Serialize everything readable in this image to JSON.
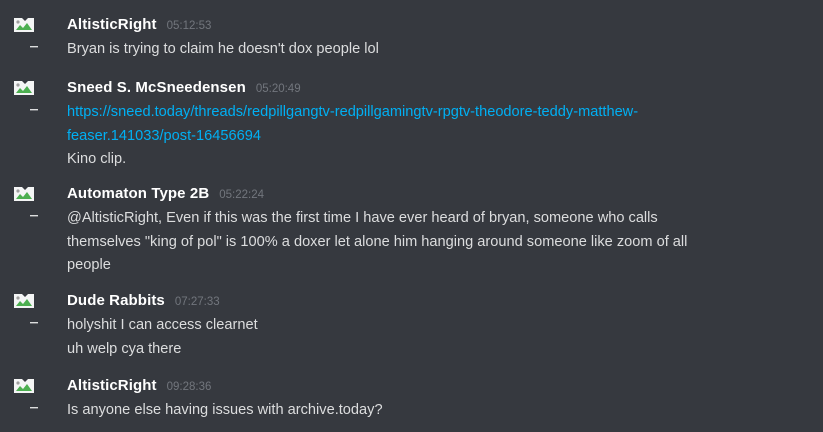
{
  "messages": [
    {
      "username": "AltisticRight",
      "timestamp": "05:12:53",
      "lines": [
        "Bryan is trying to claim he doesn't dox people lol"
      ]
    },
    {
      "username": "Sneed S. McSneedensen",
      "timestamp": "05:20:49",
      "link": {
        "line1": "https://sneed.today/threads/redpillgangtv-redpillgamingtv-rpgtv-theodore-teddy-matthew-",
        "line2": "feaser.141033/post-16456694"
      },
      "lines": [
        "Kino clip."
      ]
    },
    {
      "username": "Automaton Type 2B",
      "timestamp": "05:22:24",
      "lines": [
        "@AltisticRight, Even if this was the first time I have ever heard of bryan, someone who calls",
        "themselves \"king of pol\" is 100% a doxer let alone him hanging around someone like zoom of all",
        "people"
      ]
    },
    {
      "username": "Dude Rabbits",
      "timestamp": "07:27:33",
      "lines": [
        "holyshit I can access clearnet",
        "uh welp cya there"
      ]
    },
    {
      "username": "AltisticRight",
      "timestamp": "09:28:36",
      "lines": [
        "Is anyone else having issues with archive.today?"
      ]
    }
  ]
}
